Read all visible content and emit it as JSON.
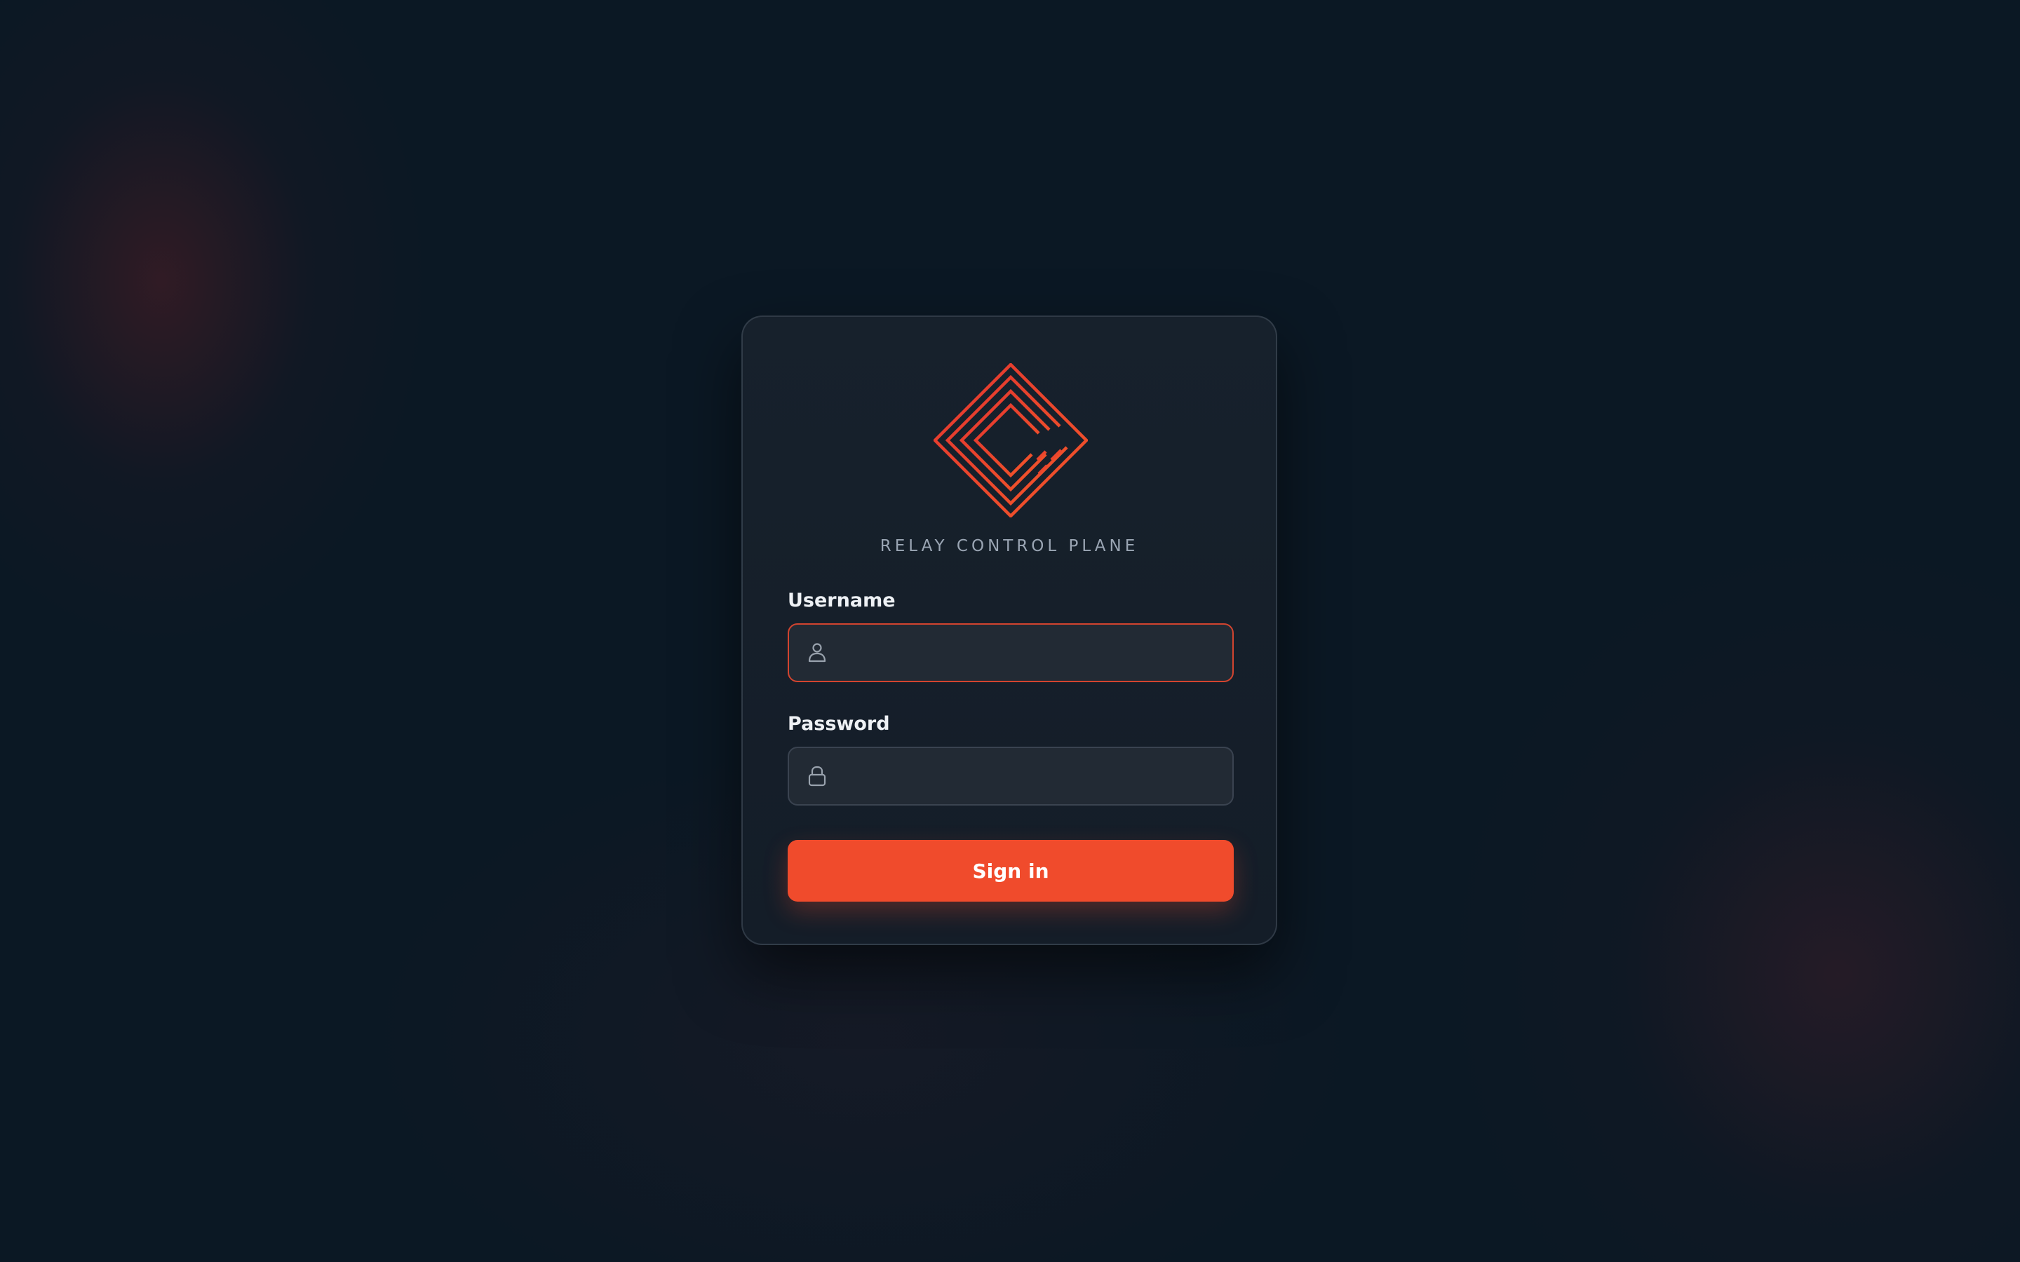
{
  "login": {
    "brand": "RELAY CONTROL PLANE",
    "username": {
      "label": "Username",
      "value": "",
      "placeholder": "",
      "icon": "user-icon",
      "state": "focused"
    },
    "password": {
      "label": "Password",
      "value": "",
      "placeholder": "",
      "icon": "lock-icon"
    },
    "submit_label": "Sign in"
  },
  "colors": {
    "background": "#0b1824",
    "card": "#161f2a",
    "accent": "#f04b2c",
    "focus_border": "#d2442f",
    "brand_text": "#9aa5b3"
  }
}
